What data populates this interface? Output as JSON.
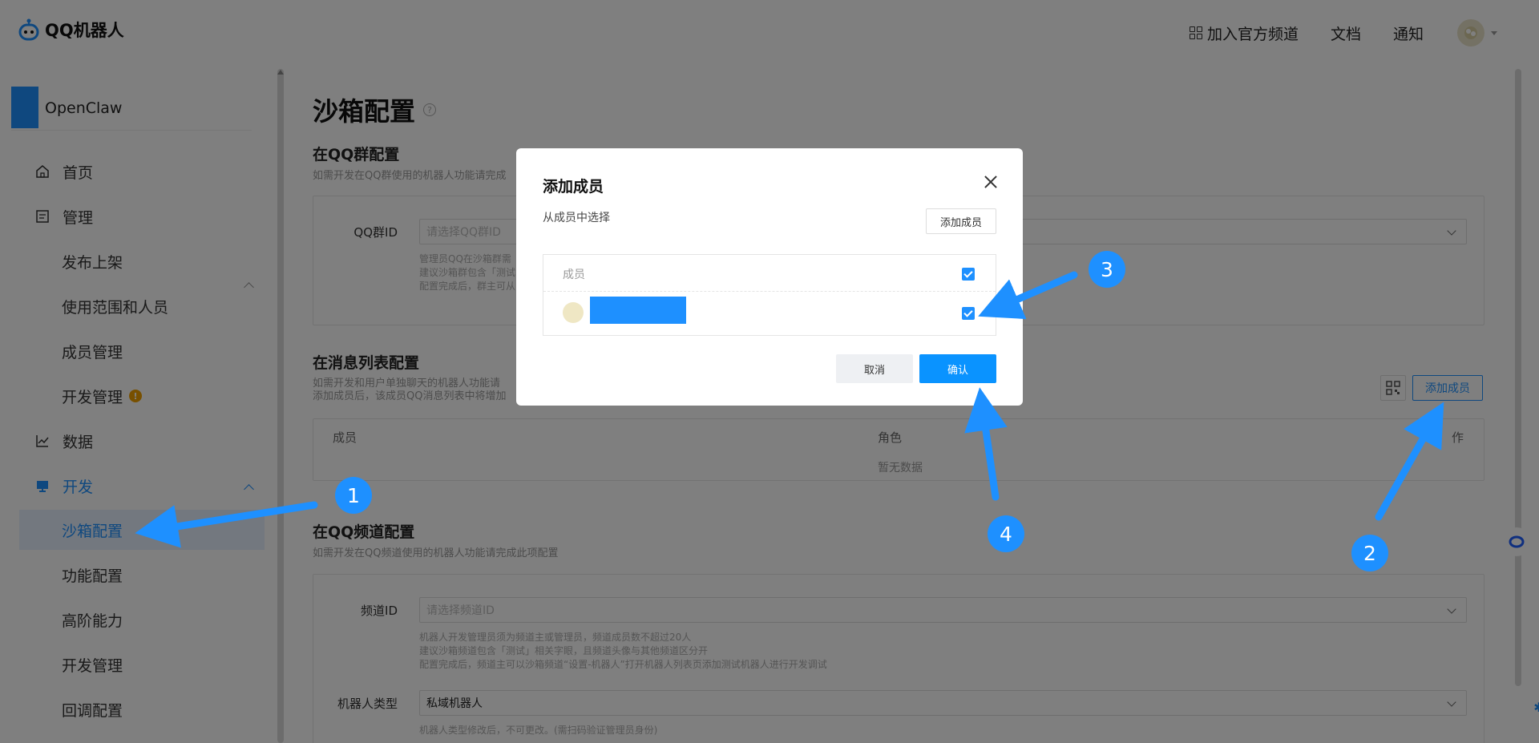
{
  "header": {
    "logo_text": "QQ机器人",
    "nav": {
      "join_channel": "加入官方频道",
      "docs": "文档",
      "notice": "通知"
    }
  },
  "sidebar": {
    "app_name": "OpenClaw",
    "items": [
      {
        "label": "首页",
        "icon": "home-icon"
      },
      {
        "label": "管理",
        "icon": "document-icon"
      },
      {
        "label": "发布上架"
      },
      {
        "label": "使用范围和人员"
      },
      {
        "label": "成员管理"
      },
      {
        "label": "开发管理",
        "badge": "!"
      },
      {
        "label": "数据",
        "icon": "chart-icon"
      },
      {
        "label": "开发",
        "icon": "monitor-icon"
      },
      {
        "label": "沙箱配置"
      },
      {
        "label": "功能配置"
      },
      {
        "label": "高阶能力"
      },
      {
        "label": "开发管理"
      },
      {
        "label": "回调配置"
      }
    ]
  },
  "main": {
    "title": "沙箱配置",
    "help": "?",
    "group_section": {
      "title": "在QQ群配置",
      "desc": "如需开发在QQ群使用的机器人功能请完成",
      "label": "QQ群ID",
      "placeholder": "请选择QQ群ID",
      "hints": [
        "管理员QQ在沙箱群需",
        "建议沙箱群包含「测试",
        "配置完成后，群主可从"
      ]
    },
    "msg_section": {
      "title": "在消息列表配置",
      "desc": [
        "如需开发和用户单独聊天的机器人功能请",
        "添加成员后，该成员QQ消息列表中将增加"
      ],
      "add_button": "添加成员",
      "col_member": "成员",
      "col_role": "角色",
      "col_action": "作",
      "empty": "暂无数据"
    },
    "channel_section": {
      "title": "在QQ频道配置",
      "desc": "如需开发在QQ频道使用的机器人功能请完成此项配置",
      "channel_label": "频道ID",
      "channel_placeholder": "请选择频道ID",
      "hints": [
        "机器人开发管理员须为频道主或管理员，频道成员数不超过20人",
        "建议沙箱频道包含「测试」相关字眼，且频道头像与其他频道区分开",
        "配置完成后，频道主可以沙箱频道“设置-机器人”打开机器人列表页添加测试机器人进行开发调试"
      ],
      "type_label": "机器人类型",
      "type_value": "私域机器人",
      "type_hint": "机器人类型修改后，不可更改。(需扫码验证管理员身份)"
    }
  },
  "modal": {
    "title": "添加成员",
    "subtitle": "从成员中选择",
    "add_button": "添加成员",
    "table_head": "成员",
    "cancel": "取消",
    "confirm": "确认"
  },
  "annotations": {
    "steps": [
      "1",
      "2",
      "3",
      "4"
    ],
    "color": "#1e90ff"
  }
}
